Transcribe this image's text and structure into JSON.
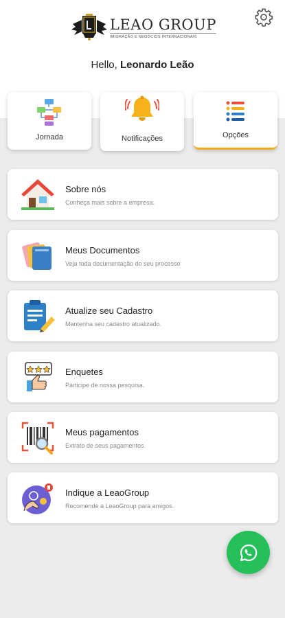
{
  "brand": {
    "name": "LEAO GROUP",
    "tagline": "IMIGRAÇÃO E NEGÓCIOS INTERNACIONAIS"
  },
  "header": {
    "greeting_prefix": "Hello,",
    "user_name": "Leonardo Leão",
    "settings_icon": "gear-icon"
  },
  "tabs": [
    {
      "label": "Jornada",
      "icon": "flowchart-icon"
    },
    {
      "label": "Notificações",
      "icon": "bell-icon"
    },
    {
      "label": "Opções",
      "icon": "list-icon",
      "active": true
    }
  ],
  "menu": [
    {
      "title": "Sobre nós",
      "subtitle": "Conheça mais sobre a empresa.",
      "icon": "house-icon"
    },
    {
      "title": "Meus Documentos",
      "subtitle": "Veja toda documentação do seu processo",
      "icon": "folders-icon"
    },
    {
      "title": "Atualize seu Cadastro",
      "subtitle": "Mantenha seu cadastro atualizado.",
      "icon": "clipboard-edit-icon"
    },
    {
      "title": "Enquetes",
      "subtitle": "Participe de nossa pesquisa.",
      "icon": "rating-thumbs-up-icon"
    },
    {
      "title": "Meus pagamentos",
      "subtitle": "Extrato de seus pagamentos.",
      "icon": "barcode-search-icon"
    },
    {
      "title": "Indique a LeaoGroup",
      "subtitle": "Recomende a LeaoGroup para amigos.",
      "icon": "referral-icon"
    }
  ],
  "fab": {
    "icon": "whatsapp-icon"
  },
  "colors": {
    "accent": "#f4a91c",
    "whatsapp": "#25c05a",
    "background": "#ececec"
  }
}
